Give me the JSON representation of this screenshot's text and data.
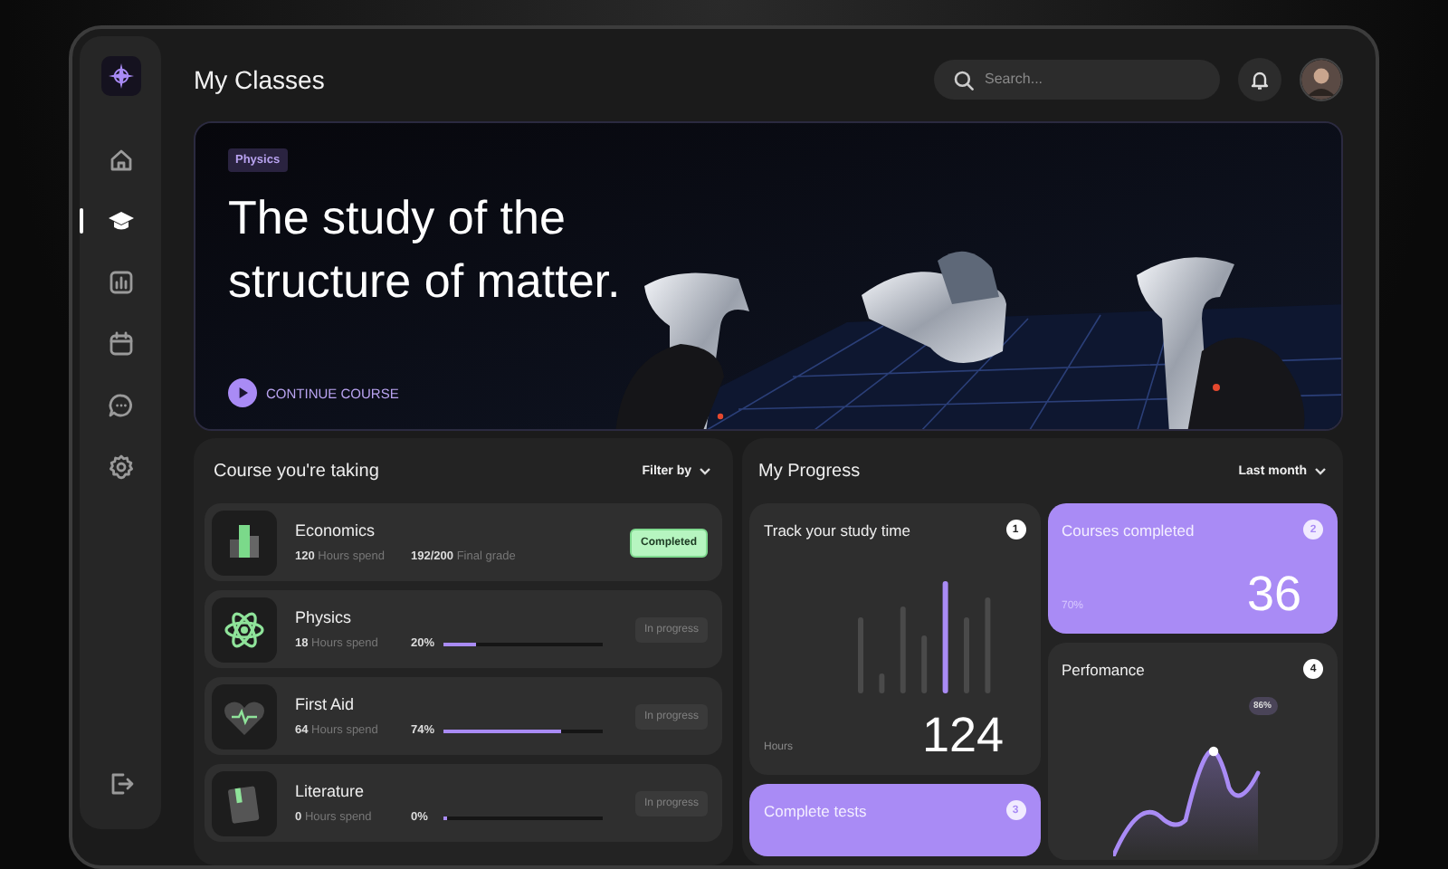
{
  "sidebar": {
    "items": [
      {
        "kind": "home",
        "selected": false
      },
      {
        "kind": "classes",
        "selected": true
      },
      {
        "kind": "stats",
        "selected": false
      },
      {
        "kind": "calendar",
        "selected": false
      },
      {
        "kind": "chat",
        "selected": false
      },
      {
        "kind": "settings",
        "selected": false
      }
    ],
    "footer_items": [
      {
        "kind": "logout",
        "selected": false
      }
    ]
  },
  "header": {
    "title": "My Classes",
    "search": {
      "placeholder": "Search..."
    }
  },
  "hero": {
    "tag": "Physics",
    "headline": "The study of the structure of matter.",
    "action": "CONTINUE COURSE"
  },
  "courses": {
    "title": "Course you're taking",
    "filter": "Filter by",
    "rows": [
      {
        "name": "Economics",
        "kind": "completed",
        "hours": "120",
        "hours_label": "Hours spend",
        "grade": "192/200",
        "grade_label": "Final grade",
        "status": "Completed"
      },
      {
        "name": "Physics",
        "kind": "progress",
        "hours": "18",
        "hours_label": "Hours spend",
        "percent": "20%",
        "level": 0.2,
        "status": "In progress"
      },
      {
        "name": "First Aid",
        "kind": "progress",
        "hours": "64",
        "hours_label": "Hours spend",
        "percent": "74%",
        "level": 0.74,
        "status": "In progress"
      },
      {
        "name": "Literature",
        "kind": "progress",
        "hours": "0",
        "hours_label": "Hours spend",
        "percent": "0%",
        "level": 0.0,
        "status": "In progress"
      }
    ]
  },
  "progress": {
    "title": "My Progress",
    "range": "Last month",
    "cards": [
      {
        "kind": "study",
        "title": "Track your study time",
        "badge": "1",
        "unit": "Hours",
        "value": "124",
        "highlighted": false
      },
      {
        "kind": "tests",
        "title": "Complete tests",
        "badge": "3",
        "highlighted": true
      },
      {
        "kind": "courses",
        "title": "Courses completed",
        "badge": "2",
        "note": "70%",
        "value": "36",
        "highlighted": true
      },
      {
        "kind": "performance",
        "title": "Perfomance",
        "badge": "4",
        "peak_label": "86%",
        "highlighted": false
      }
    ]
  }
}
